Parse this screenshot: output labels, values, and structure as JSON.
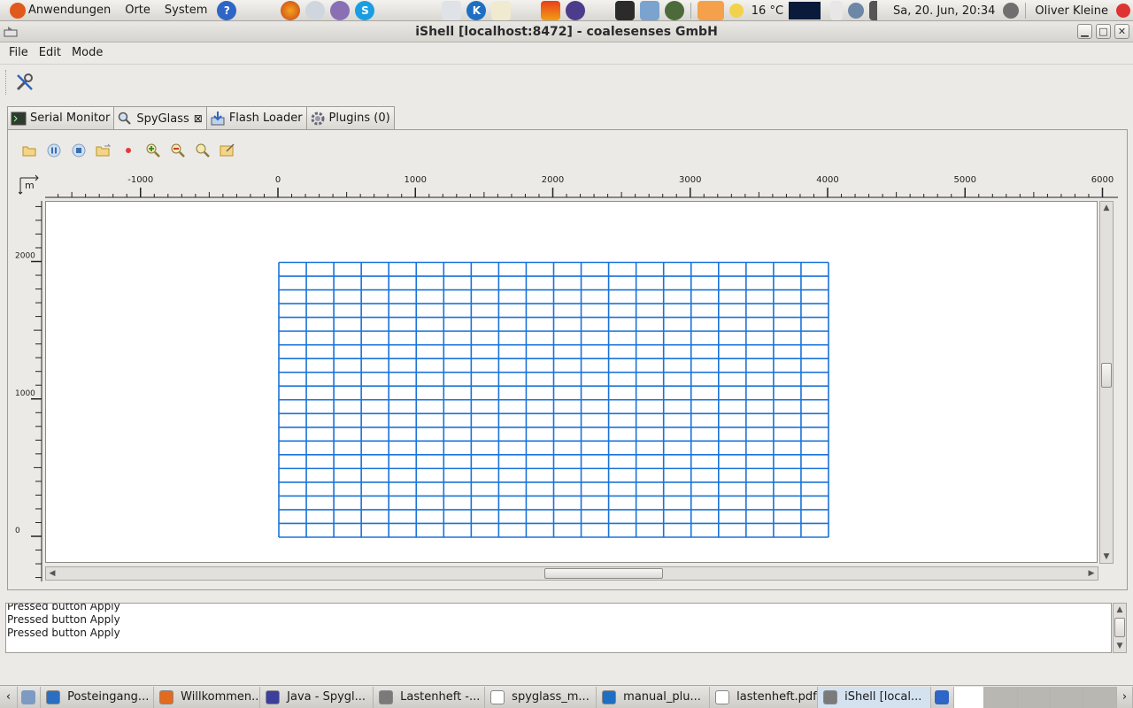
{
  "top_panel": {
    "menus": [
      "Anwendungen",
      "Orte",
      "System"
    ],
    "weather": "16 °C",
    "datetime": "Sa, 20. Jun, 20:34",
    "user": "Oliver Kleine"
  },
  "window": {
    "title": "iShell [localhost:8472] - coalesenses GmbH",
    "buttons": {
      "minimize": "▁",
      "maximize": "□",
      "close": "✕"
    }
  },
  "menubar": {
    "file": "File",
    "edit": "Edit",
    "mode": "Mode"
  },
  "tabs": [
    {
      "label": "Serial Monitor"
    },
    {
      "label": "SpyGlass"
    },
    {
      "label": "Flash Loader"
    },
    {
      "label": "Plugins (0)"
    }
  ],
  "ruler": {
    "unit": "m",
    "x_ticks": [
      "-1000",
      "0",
      "1000",
      "2000",
      "3000",
      "4000",
      "5000",
      "6000"
    ],
    "y_ticks": [
      "2000",
      "1000",
      "0"
    ]
  },
  "grid": {
    "x_range": [
      0,
      4000
    ],
    "y_range": [
      0,
      2000
    ],
    "columns": 20,
    "rows": 20,
    "color": "#1a73d9"
  },
  "log": {
    "lines": [
      "Pressed button Apply",
      "Pressed button Apply",
      "Pressed button Apply"
    ]
  },
  "taskbar": {
    "items": [
      {
        "label": "Posteingang...",
        "color": "#2a6fc2"
      },
      {
        "label": "Willkommen...",
        "color": "#e26b1f"
      },
      {
        "label": "Java - Spygl...",
        "color": "#3b3e9b"
      },
      {
        "label": "Lastenheft -...",
        "color": "#7a7a7a"
      },
      {
        "label": "spyglass_m...",
        "color": "#ffffff"
      },
      {
        "label": "manual_plu...",
        "color": "#1e6fc3"
      },
      {
        "label": "lastenheft.pdf",
        "color": "#ffffff"
      },
      {
        "label": "iShell [local...",
        "color": "#7a7a7a"
      }
    ]
  }
}
